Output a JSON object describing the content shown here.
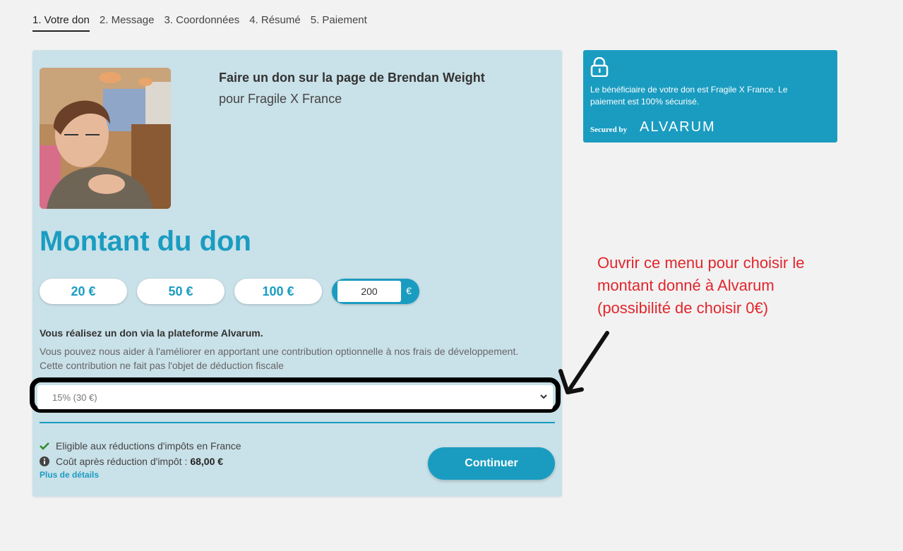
{
  "steps": [
    {
      "label": "1. Votre don",
      "active": true
    },
    {
      "label": "2. Message"
    },
    {
      "label": "3. Coordonnées"
    },
    {
      "label": "4. Résumé"
    },
    {
      "label": "5. Paiement"
    }
  ],
  "intro": {
    "title": "Faire un don sur la page de Brendan Weight",
    "subtitle": "pour Fragile X France"
  },
  "amount": {
    "title": "Montant du don",
    "presets": [
      "20 €",
      "50 €",
      "100 €"
    ],
    "custom_value": "200",
    "currency": "€"
  },
  "platform": {
    "heading": "Vous réalisez un don via la plateforme Alvarum.",
    "line1": "Vous pouvez nous aider à l'améliorer en apportant une contribution optionnelle à nos frais de développement.",
    "line2": "Cette contribution ne fait pas l'objet de déduction fiscale",
    "tip_selected": "15% (30 €)"
  },
  "fiscal": {
    "eligible": "Eligible aux réductions d'impôts en France",
    "cost_label": "Coût après réduction d'impôt :",
    "cost_value": "68,00 €",
    "details_link": "Plus de détails"
  },
  "continue_label": "Continuer",
  "secure": {
    "message": "Le bénéficiaire de votre don est Fragile X France. Le paiement est 100% sécurisé.",
    "secured_by": "Secured by",
    "brand": "ALVARUM"
  },
  "annotation": {
    "line1": "Ouvrir ce menu pour choisir le",
    "line2": "montant donné à Alvarum",
    "line3": "(possibilité de choisir 0€)"
  },
  "colors": {
    "accent": "#1a9cc1",
    "card_bg": "#c9e1e8",
    "annotation": "#e1262c"
  },
  "icons": [
    "lock-icon",
    "check-icon",
    "info-icon",
    "chevron-down-icon",
    "arrow-annotation"
  ]
}
